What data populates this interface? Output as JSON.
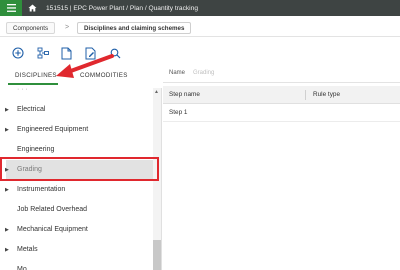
{
  "header": {
    "breadcrumb": "151515 | EPC Power Plant  /  Plan  /  Quantity tracking"
  },
  "breadcrumb": {
    "items": [
      "Components",
      "Disciplines and claiming schemes"
    ],
    "separator": ">"
  },
  "toolbar": {
    "icons": [
      "add-icon",
      "hierarchy-icon",
      "document-icon",
      "document-edit-icon",
      "search-icon"
    ]
  },
  "tabs": [
    {
      "label": "DISCIPLINES",
      "active": true
    },
    {
      "label": "COMMODITIES",
      "active": false
    }
  ],
  "disciplines": [
    {
      "label": "Electrical",
      "expandable": true
    },
    {
      "label": "Engineered Equipment",
      "expandable": true
    },
    {
      "label": "Engineering",
      "expandable": false
    },
    {
      "label": "Grading",
      "expandable": true,
      "selected": true
    },
    {
      "label": "Instrumentation",
      "expandable": true
    },
    {
      "label": "Job Related Overhead",
      "expandable": false
    },
    {
      "label": "Mechanical Equipment",
      "expandable": true
    },
    {
      "label": "Metals",
      "expandable": true
    },
    {
      "label": "Mo...",
      "expandable": false
    }
  ],
  "detail": {
    "name_label": "Name",
    "name_value": "Grading",
    "columns": [
      "Step name",
      "Rule type"
    ],
    "rows": [
      {
        "step_name": "Step 1",
        "rule_type": ""
      }
    ]
  },
  "colors": {
    "topbar": "#3e4443",
    "accent": "#2f8f3c",
    "annotation": "#e0282e"
  }
}
